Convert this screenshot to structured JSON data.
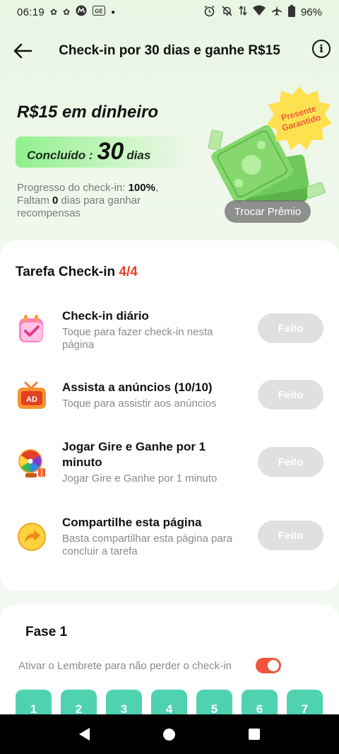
{
  "status_bar": {
    "time": "06:19",
    "battery": "96%",
    "icons": [
      "notification-icon",
      "notification-icon",
      "motorola-icon",
      "g-icon",
      "dot-icon",
      "alarm-icon",
      "mute-icon",
      "data-icon",
      "wifi-icon",
      "airplane-icon",
      "battery-icon"
    ]
  },
  "header": {
    "title": "Check-in por 30 dias e ganhe R$15"
  },
  "hero": {
    "reward_title": "R$15 em dinheiro",
    "done_label": "Concluído :",
    "done_days": "30",
    "done_unit": "dias",
    "progress_prefix": "Progresso do check-in: ",
    "progress_value": "100%",
    "progress_mid": ",",
    "remaining_prefix": "Faltam ",
    "remaining_value": "0",
    "remaining_suffix": " dias para ganhar recompensas",
    "badge_line1": "Presente",
    "badge_line2": "Garantido",
    "trade_button": "Trocar Prêmio"
  },
  "tasks": {
    "title": "Tarefa Check-in ",
    "count": "4/4",
    "items": [
      {
        "name": "Check-in diário",
        "desc": "Toque para fazer check-in nesta página",
        "button": "Feito"
      },
      {
        "name": "Assista a anúncios  (10/10)",
        "desc": "Toque para assistir aos anúncios",
        "button": "Feito"
      },
      {
        "name": "Jogar Gire e Ganhe por 1 minuto",
        "desc": "Jogar Gire e Ganhe por 1 minuto",
        "button": "Feito"
      },
      {
        "name": "Compartilhe esta página",
        "desc": "Basta compartilhar esta página para concluir a tarefa",
        "button": "Feito"
      }
    ]
  },
  "phase": {
    "title": "Fase 1",
    "reminder": "Ativar o Lembrete para não perder o check-in",
    "reminder_on": true,
    "days": [
      "1",
      "2",
      "3",
      "4",
      "5",
      "6",
      "7"
    ]
  },
  "colors": {
    "accent_red": "#e8412b",
    "day_green": "#4fd2b0",
    "toggle_on": "#f0553b"
  }
}
